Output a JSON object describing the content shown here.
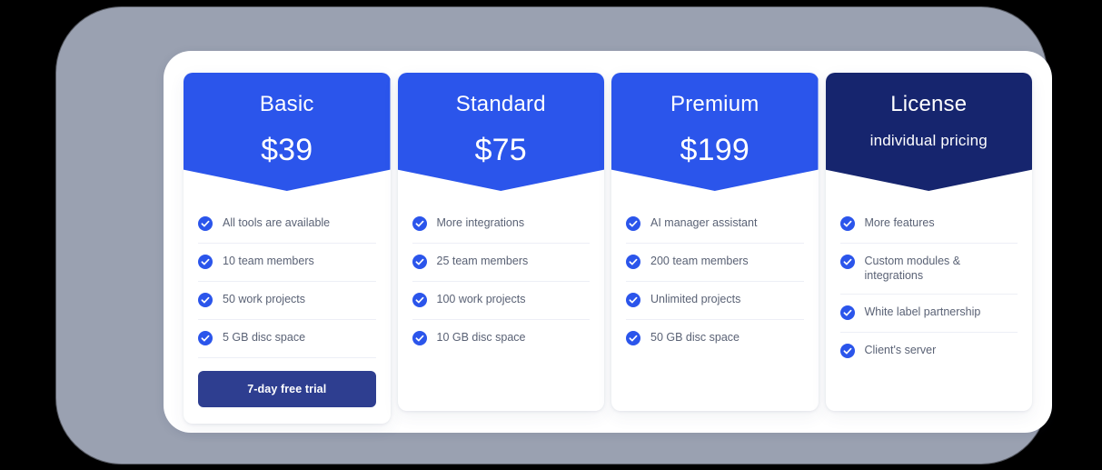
{
  "theme": {
    "page_background": "#000000",
    "frame_background": "#9AA1B1",
    "panel_background": "#FFFFFF",
    "card_background": "#FFFFFF",
    "accent_blue": "#2B55EB",
    "accent_navy": "#16256E",
    "cta_navy": "#2E3E90",
    "feature_text": "#5A6275",
    "divider": "#EDEFF6"
  },
  "plans": [
    {
      "name": "Basic",
      "price": "$39",
      "price_size": "large",
      "header_accent": "blue",
      "features": [
        "All tools are available",
        "10 team members",
        "50 work projects",
        "5 GB disc space"
      ],
      "cta_label": "7-day free trial",
      "has_cta": true
    },
    {
      "name": "Standard",
      "price": "$75",
      "price_size": "large",
      "header_accent": "blue",
      "features": [
        "More integrations",
        "25 team members",
        "100 work projects",
        "10 GB disc space"
      ],
      "cta_label": "",
      "has_cta": false
    },
    {
      "name": "Premium",
      "price": "$199",
      "price_size": "large",
      "header_accent": "blue",
      "features": [
        "AI manager assistant",
        "200 team members",
        "Unlimited projects",
        "50 GB disc space"
      ],
      "cta_label": "",
      "has_cta": false
    },
    {
      "name": "License",
      "price": "individual pricing",
      "price_size": "small",
      "header_accent": "navy",
      "features": [
        "More features",
        "Custom modules & integrations",
        "White label partnership",
        "Client's server"
      ],
      "cta_label": "",
      "has_cta": false
    }
  ],
  "icons": {
    "check_circle": "check-circle-icon"
  }
}
